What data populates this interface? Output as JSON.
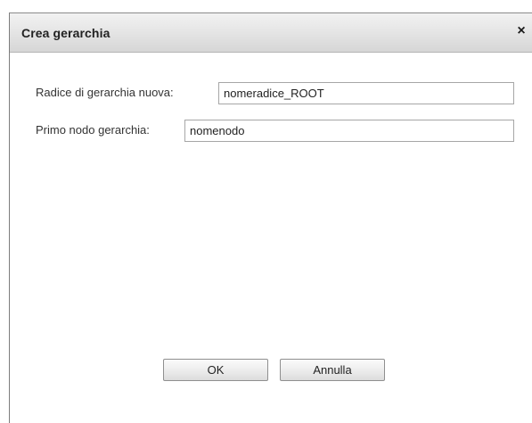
{
  "dialog": {
    "title": "Crea gerarchia",
    "close_symbol": "×",
    "close_icon": "close-icon"
  },
  "form": {
    "root_label": "Radice di gerarchia nuova:",
    "root_value": "nomeradice_ROOT",
    "first_node_label": "Primo nodo gerarchia:",
    "first_node_value": "nomenodo"
  },
  "buttons": {
    "ok_label": "OK",
    "cancel_label": "Annulla"
  }
}
